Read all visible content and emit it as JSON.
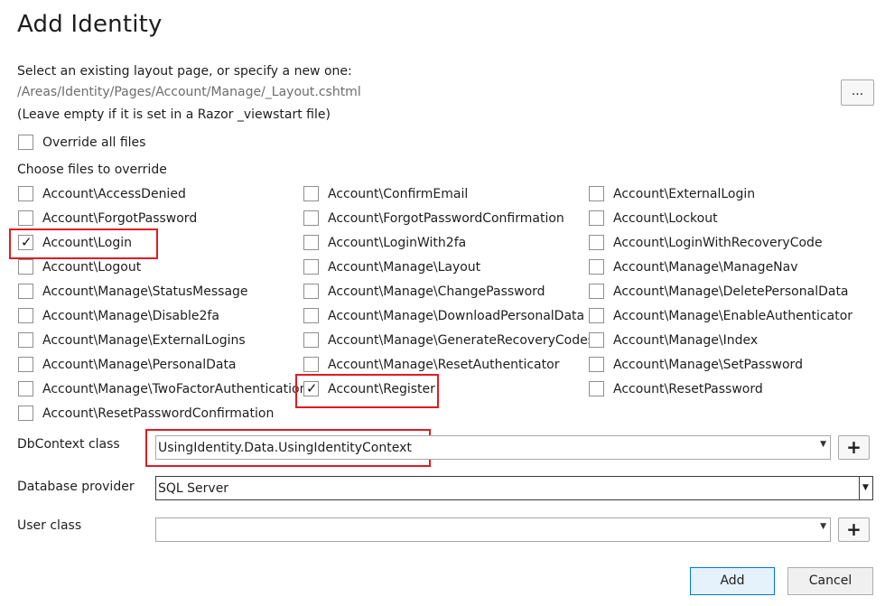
{
  "dialog": {
    "title": "Add Identity",
    "layout_prompt": "Select an existing layout page, or specify a new one:",
    "layout_path_value": "/Areas/Identity/Pages/Account/Manage/_Layout.cshtml",
    "layout_hint": "(Leave empty if it is set in a Razor _viewstart file)",
    "browse_label": "...",
    "override_all_label": "Override all files",
    "choose_files_label": "Choose files to override"
  },
  "files": {
    "col1": [
      {
        "label": "Account\\AccessDenied",
        "checked": false
      },
      {
        "label": "Account\\ForgotPassword",
        "checked": false
      },
      {
        "label": "Account\\Login",
        "checked": true
      },
      {
        "label": "Account\\Logout",
        "checked": false
      },
      {
        "label": "Account\\Manage\\StatusMessage",
        "checked": false
      },
      {
        "label": "Account\\Manage\\Disable2fa",
        "checked": false
      },
      {
        "label": "Account\\Manage\\ExternalLogins",
        "checked": false
      },
      {
        "label": "Account\\Manage\\PersonalData",
        "checked": false
      },
      {
        "label": "Account\\Manage\\TwoFactorAuthentication",
        "checked": false
      },
      {
        "label": "Account\\ResetPasswordConfirmation",
        "checked": false
      }
    ],
    "col2": [
      {
        "label": "Account\\ConfirmEmail",
        "checked": false
      },
      {
        "label": "Account\\ForgotPasswordConfirmation",
        "checked": false
      },
      {
        "label": "Account\\LoginWith2fa",
        "checked": false
      },
      {
        "label": "Account\\Manage\\Layout",
        "checked": false
      },
      {
        "label": "Account\\Manage\\ChangePassword",
        "checked": false
      },
      {
        "label": "Account\\Manage\\DownloadPersonalData",
        "checked": false
      },
      {
        "label": "Account\\Manage\\GenerateRecoveryCodes",
        "checked": false
      },
      {
        "label": "Account\\Manage\\ResetAuthenticator",
        "checked": false
      },
      {
        "label": "Account\\Register",
        "checked": true
      }
    ],
    "col3": [
      {
        "label": "Account\\ExternalLogin",
        "checked": false
      },
      {
        "label": "Account\\Lockout",
        "checked": false
      },
      {
        "label": "Account\\LoginWithRecoveryCode",
        "checked": false
      },
      {
        "label": "Account\\Manage\\ManageNav",
        "checked": false
      },
      {
        "label": "Account\\Manage\\DeletePersonalData",
        "checked": false
      },
      {
        "label": "Account\\Manage\\EnableAuthenticator",
        "checked": false
      },
      {
        "label": "Account\\Manage\\Index",
        "checked": false
      },
      {
        "label": "Account\\Manage\\SetPassword",
        "checked": false
      },
      {
        "label": "Account\\ResetPassword",
        "checked": false
      }
    ]
  },
  "form": {
    "dbcontext_label": "DbContext class",
    "dbcontext_value": "UsingIdentity.Data.UsingIdentityContext",
    "provider_label": "Database provider",
    "provider_value": "SQL Server",
    "user_class_label": "User class",
    "user_class_value": "",
    "plus_label": "+"
  },
  "buttons": {
    "add_label": "Add",
    "cancel_label": "Cancel"
  },
  "icons": {
    "checkmark": "checkmark-icon",
    "dropdown": "chevron-down-icon"
  },
  "colors": {
    "highlight": "#e11b22",
    "primary_border": "#0078d7"
  }
}
